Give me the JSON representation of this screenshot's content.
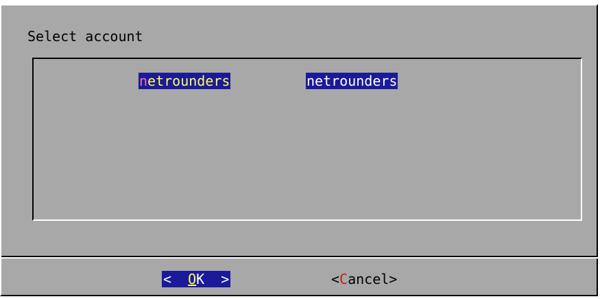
{
  "dialog": {
    "title": "Select account"
  },
  "list": {
    "items": [
      {
        "tag_first": "n",
        "tag_rest": "etrounders",
        "item": "netrounders",
        "selected": true
      }
    ]
  },
  "buttons": {
    "ok": {
      "open": "<  ",
      "hotkey": "O",
      "rest": "K  >"
    },
    "cancel": {
      "open": "<",
      "hotkey": "C",
      "rest": "ancel>"
    }
  },
  "colors": {
    "dialog_bg": "#a8a8a8",
    "highlight_bg": "#1a1a9a",
    "hotkey_fg": "#ffff55",
    "cancel_hotkey": "#c81a1a"
  }
}
